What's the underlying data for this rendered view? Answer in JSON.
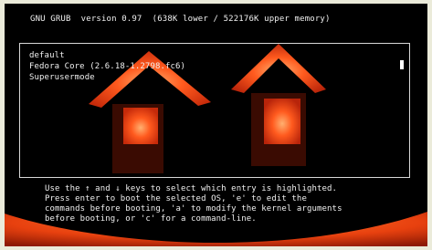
{
  "header": {
    "title": "GNU GRUB  version 0.97  (638K lower / 522176K upper memory)"
  },
  "menu": {
    "entries": [
      {
        "label": "default"
      },
      {
        "label": "Fedora Core (2.6.18-1.2798.fc6)"
      },
      {
        "label": "Superusermode"
      }
    ]
  },
  "help": {
    "lines": [
      "Use the ↑ and ↓ keys to select which entry is highlighted.",
      "Press enter to boot the selected OS, 'e' to edit the",
      "commands before booting, 'a' to modify the kernel arguments",
      "before booting, or 'c' for a command-line."
    ]
  },
  "colors": {
    "background": "#000000",
    "text": "#f0f0f0",
    "frame": "#ebebda",
    "pumpkin_glow": "#ff4a1a"
  }
}
